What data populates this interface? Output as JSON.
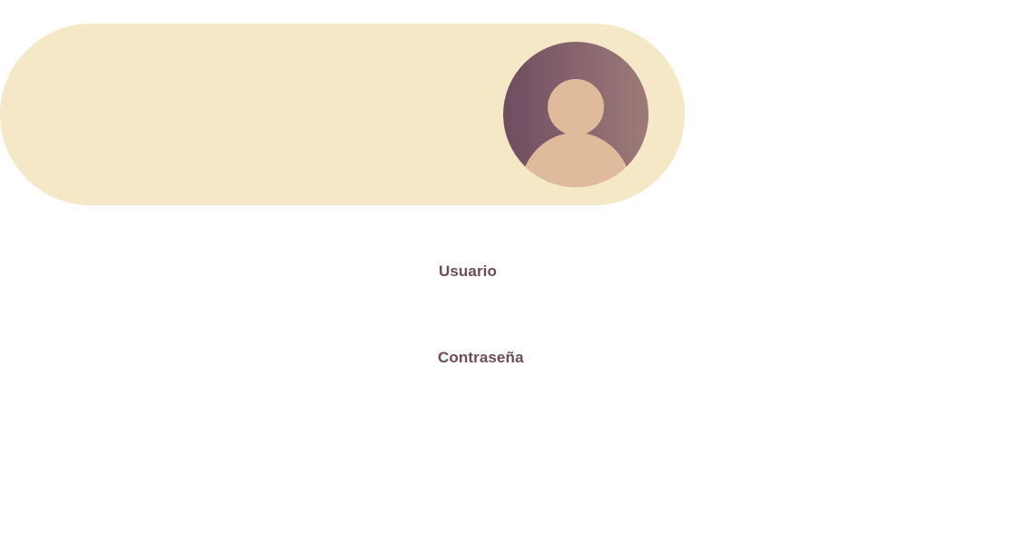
{
  "login": {
    "username_label": "Usuario",
    "username_value": "",
    "password_label": "Contraseña",
    "password_value": ""
  },
  "colors": {
    "banner_bg": "#f4e8c7",
    "label_text": "#6e4b5b",
    "avatar_gradient_start": "#6f4c5f",
    "avatar_gradient_end": "#9c7b78",
    "avatar_figure": "#dfbb9c"
  },
  "icons": {
    "avatar": "user-avatar-icon"
  }
}
